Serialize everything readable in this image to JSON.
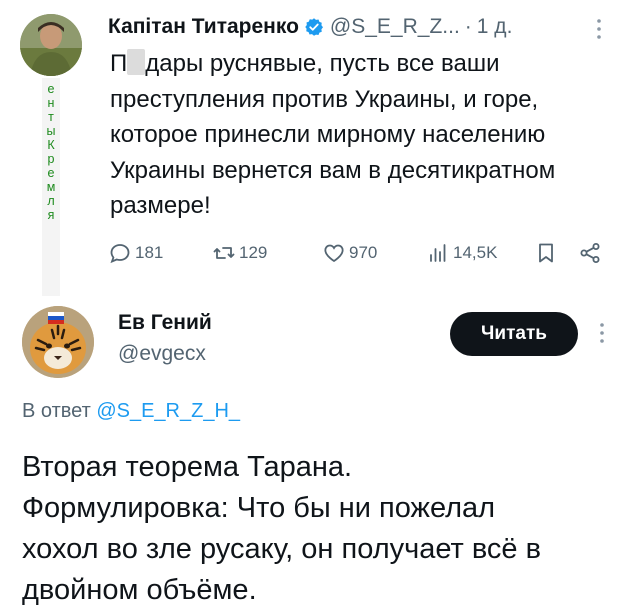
{
  "tweet1": {
    "author_name": "Капітан Титаренко",
    "author_handle": "@S_E_R_Z...",
    "separator": "·",
    "time": "1 д.",
    "text_masked_prefix": "П",
    "text_rest": "дары руснявые, пусть все ваши\nпреступления против Украины, и горе,\nкоторое принесли мирному населению\nУкраины вернется вам в десятикратном\nразмере!",
    "avatar_overlay_text": [
      "е",
      "н",
      "т",
      "ы",
      " ",
      "К",
      "р",
      "е",
      "м",
      "л",
      "я"
    ],
    "stats": {
      "replies": "181",
      "reposts": "129",
      "likes": "970",
      "views": "14,5K"
    }
  },
  "tweet2": {
    "author_name": "Ев Гений",
    "author_handle": "@evgecx",
    "follow_label": "Читать",
    "reply_prefix": "В ответ",
    "reply_handle": "@S_E_R_Z_H_",
    "text": "Вторая теорема Тарана.\nФормулировка: Что бы ни пожелал\nхохол во зле русаку, он получает всё в\nдвойном объёме."
  },
  "colors": {
    "text_primary": "#0f1419",
    "text_secondary": "#536471",
    "accent_blue": "#1d9bf0",
    "overlay_green": "#1d8a1d"
  },
  "icons": [
    "verified-badge-icon",
    "more-options-icon",
    "reply-icon",
    "repost-icon",
    "like-icon",
    "views-icon",
    "bookmark-icon",
    "share-icon"
  ]
}
